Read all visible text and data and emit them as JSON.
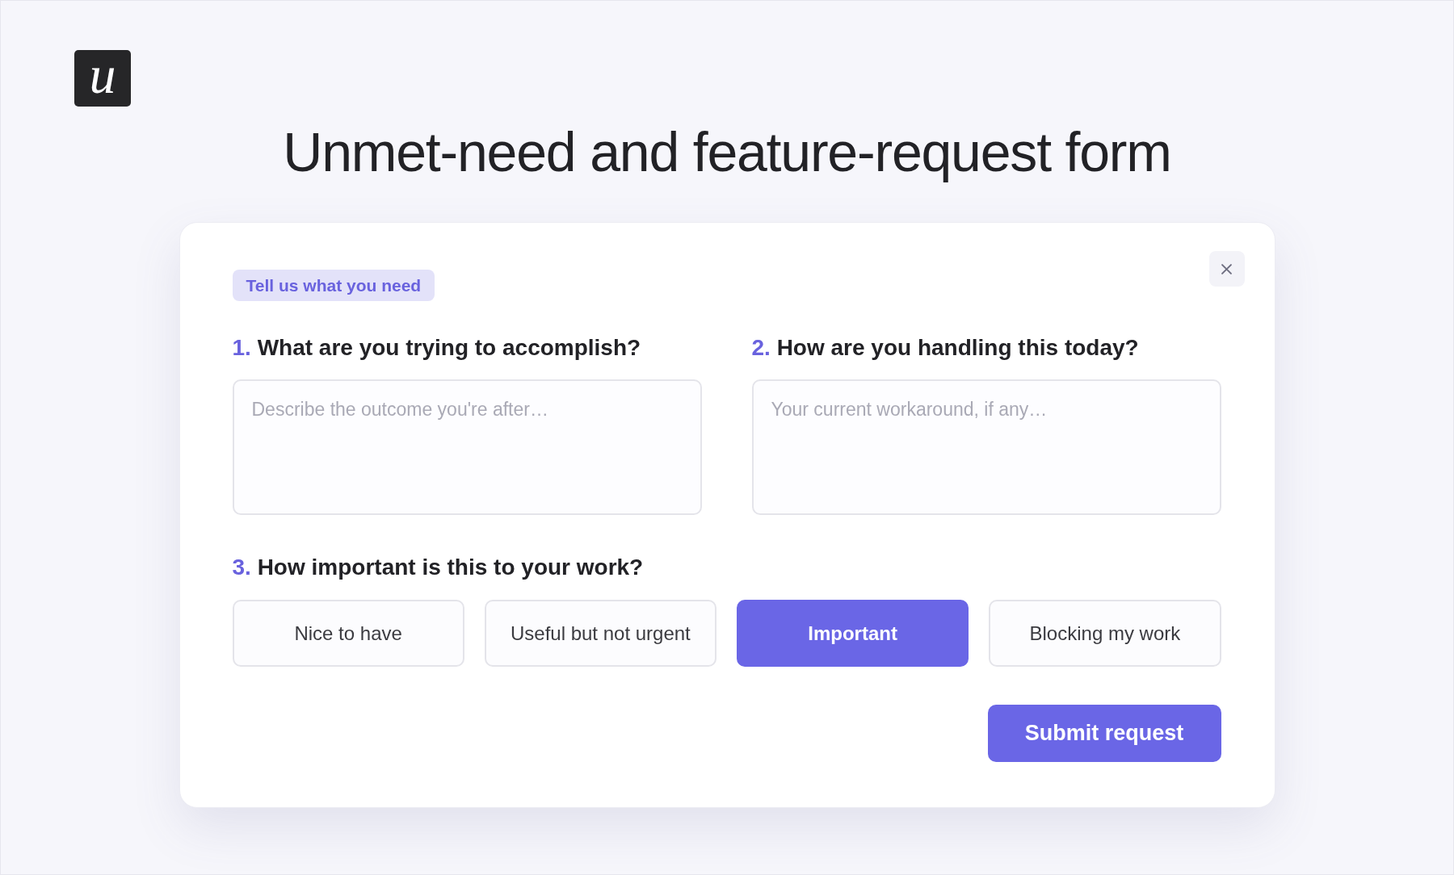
{
  "logo": {
    "letter": "u"
  },
  "title": "Unmet-need and feature-request form",
  "form": {
    "badge": "Tell us what you need",
    "open_questions": [
      {
        "number": "1.",
        "text": "What are you trying to accomplish?",
        "placeholder": "Describe the outcome you're after…"
      },
      {
        "number": "2.",
        "text": "How are you handling this today?",
        "placeholder": "Your current workaround, if any…"
      }
    ],
    "importance_question": {
      "number": "3.",
      "text": "How important is this to your work?"
    },
    "importance_options": [
      {
        "label": "Nice to have",
        "selected": false
      },
      {
        "label": "Useful but not urgent",
        "selected": false
      },
      {
        "label": "Important",
        "selected": true
      },
      {
        "label": "Blocking my work",
        "selected": false
      }
    ],
    "submit_button": "Submit request"
  }
}
